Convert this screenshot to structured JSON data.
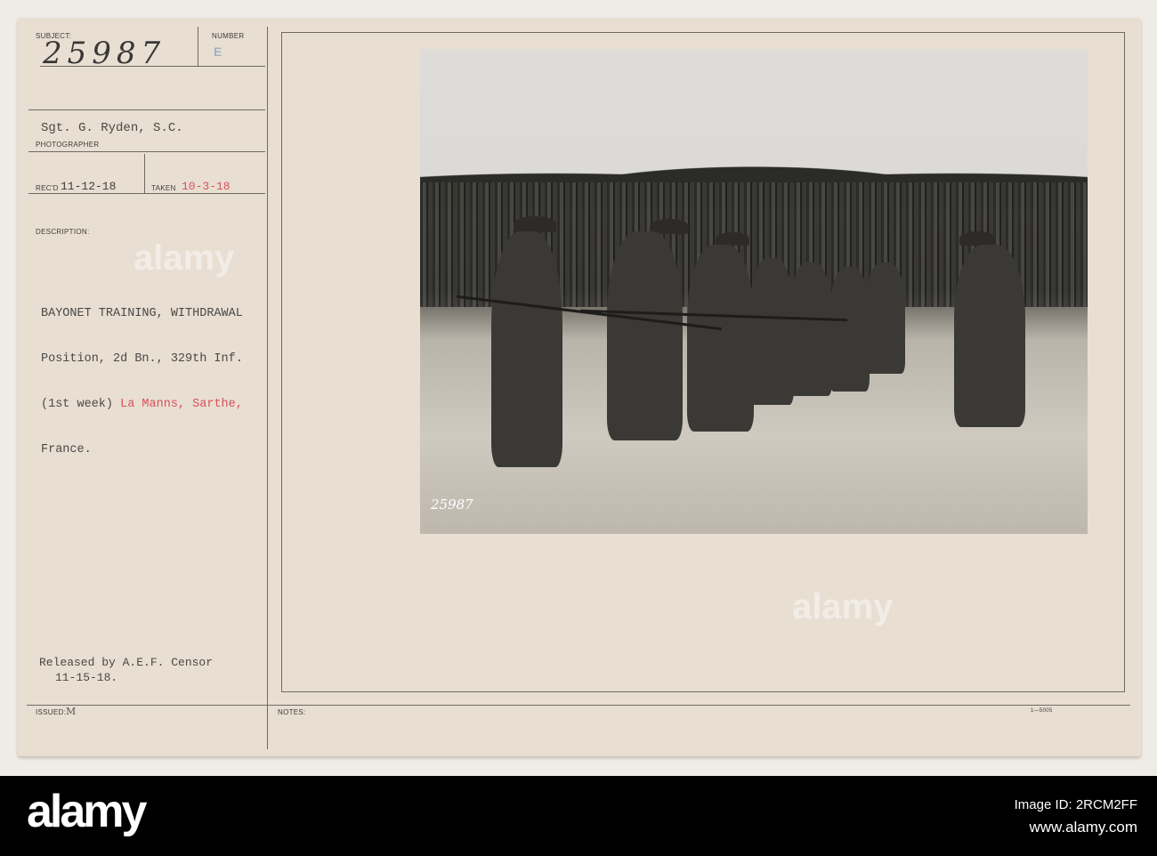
{
  "card": {
    "subject_label": "SUBJECT:",
    "subject_number": "25987",
    "number_label": "NUMBER",
    "number_value": "E",
    "photographer": "Sgt. G. Ryden, S.C.",
    "photographer_label": "PHOTOGRAPHER",
    "recd_label": "REC'D",
    "recd_date": "11-12-18",
    "taken_label": "TAKEN",
    "taken_date": "10-3-18",
    "description_label": "DESCRIPTION:",
    "description": {
      "line1": "BAYONET TRAINING, WITHDRAWAL",
      "line2": "Position, 2d Bn., 329th Inf.",
      "line3a": "(1st week) ",
      "line3b": "La Manns, Sarthe,",
      "line4": "France."
    },
    "released_line1": "Released by A.E.F. Censor",
    "released_line2": "11-15-18.",
    "issued_label": "ISSUED:",
    "issued_value": "M",
    "notes_label": "NOTES:",
    "form_number": "1—5005"
  },
  "photo": {
    "stamp_text": "25987",
    "colors": {
      "ink_red": "#d9505b",
      "card": "#e8dfd2"
    }
  },
  "watermark": {
    "text": "alamy"
  },
  "footer": {
    "logo": "alamy",
    "image_id": "Image ID: 2RCM2FF",
    "url": "www.alamy.com"
  }
}
